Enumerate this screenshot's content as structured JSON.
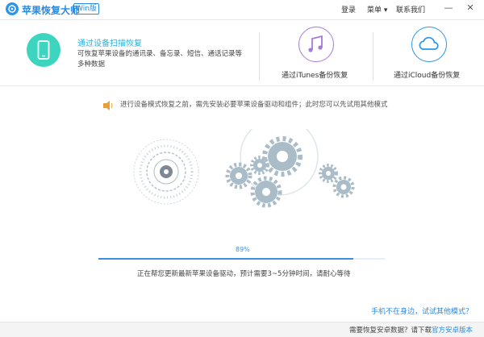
{
  "titlebar": {
    "app_title": "苹果恢复大师",
    "badge": "Win版",
    "login": "登录",
    "menu": "菜单",
    "menu_arrow": "▾",
    "contact": "联系我们",
    "minimize": "—",
    "close": "✕"
  },
  "options": {
    "device": {
      "title": "通过设备扫描恢复",
      "desc": "可恢复苹果设备的通讯录、备忘录、短信、通话记录等多种数据",
      "color": "#3dd5c0"
    },
    "itunes": {
      "label": "通过iTunes备份恢复",
      "color": "#a47cdb"
    },
    "icloud": {
      "label": "通过iCloud备份恢复",
      "color": "#2b95e9"
    }
  },
  "notice": "进行设备模式恢复之前，需先安装必要苹果设备驱动和组件；此时您可以先试用其他模式",
  "progress": {
    "percent_label": "89%",
    "value": 0.89
  },
  "status": "正在帮您更新最新苹果设备驱动，预计需要3~5分钟时间，请耐心等待",
  "alt_link": "手机不在身边，试试其他模式？",
  "footer": {
    "prefix": "需要恢复安卓数据？请下载",
    "link": "官方安卓版本"
  },
  "colors": {
    "accent": "#2b8be0",
    "gear": "#a9bcc8"
  }
}
